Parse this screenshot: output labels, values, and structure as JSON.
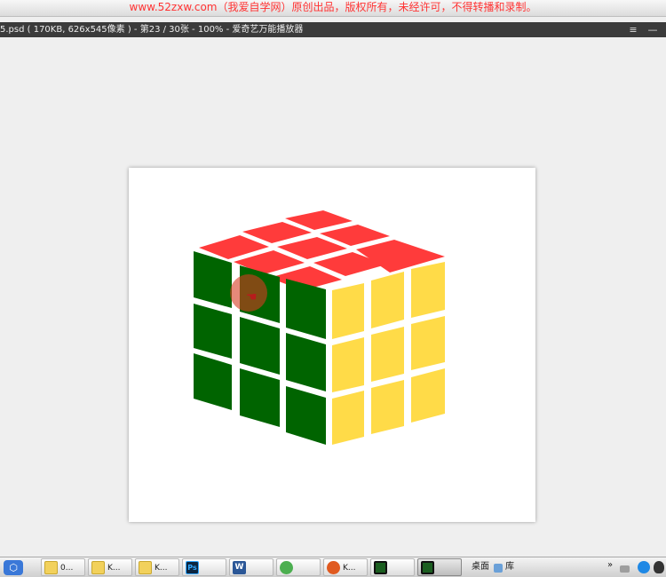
{
  "watermark": "www.52zxw.com（我爱自学网）原创出品，版权所有，未经许可，不得转播和录制。",
  "window": {
    "title": "5.psd ( 170KB, 626x545像素 ) - 第23 / 30张 - 100% - 爱奇艺万能播放器",
    "menu_icon": "≡",
    "minimize_icon": "—"
  },
  "cube_colors": {
    "top": "#ff3b3b",
    "left": "#006400",
    "right": "#ffdb48"
  },
  "taskbar": {
    "start_icon": "⬡",
    "items": [
      {
        "label": "0..."
      },
      {
        "label": "K..."
      },
      {
        "label": "K..."
      },
      {
        "label": "Ps"
      },
      {
        "label": "W"
      },
      {
        "label": ""
      },
      {
        "label": "K..."
      },
      {
        "label": ""
      },
      {
        "label": ""
      }
    ],
    "desktop_label": "桌面",
    "library_label": "库",
    "overflow_icon": "»"
  }
}
